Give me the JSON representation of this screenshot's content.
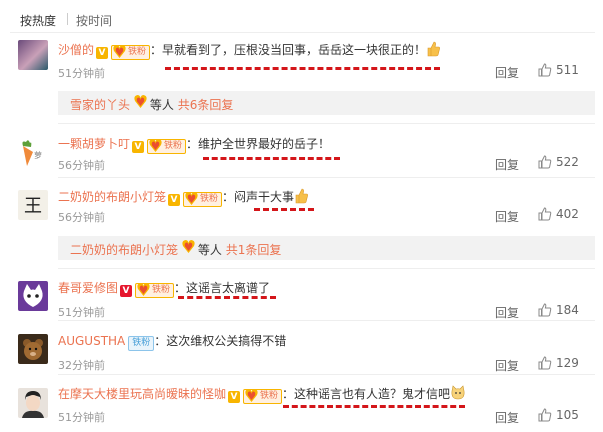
{
  "tabs": {
    "hot": "按热度",
    "time": "按时间"
  },
  "comments": [
    {
      "user": "沙僧的",
      "v": "V",
      "fan": "铁粉",
      "text": "：早就看到了，压根没当回事，岳岳这一块很正的！",
      "time": "51分钟前",
      "reply": "回复",
      "likes": "511"
    },
    {
      "user": "一颗胡萝卜叮",
      "v": "V",
      "fan": "铁粉",
      "text": "：维护全世界最好的岳子！",
      "time": "56分钟前",
      "reply": "回复",
      "likes": "522"
    },
    {
      "user": "二奶奶的布朗小灯笼",
      "v": "V",
      "fan": "铁粉",
      "text": "：闷声干大事",
      "time": "56分钟前",
      "reply": "回复",
      "likes": "402"
    },
    {
      "user": "春哥爱修图",
      "v": "V",
      "fan": "铁粉",
      "text": "：这谣言太离谱了",
      "time": "51分钟前",
      "reply": "回复",
      "likes": "184"
    },
    {
      "user": "AUGUSTHA",
      "v": "",
      "fan": "铁粉",
      "text": "：这次维权公关搞得不错",
      "time": "32分钟前",
      "reply": "回复",
      "likes": "129"
    },
    {
      "user": "在摩天大楼里玩高尚暧昧的怪咖",
      "v": "V",
      "fan": "铁粉",
      "text": "：这种谣言也有人造？鬼才信吧",
      "time": "51分钟前",
      "reply": "回复",
      "likes": "105"
    }
  ],
  "subreplies": [
    {
      "user": "雪家的丫头",
      "mid": "等人",
      "count": "共6条回复"
    },
    {
      "user": "二奶奶的布朗小灯笼",
      "mid": "等人",
      "count": "共1条回复"
    }
  ],
  "colors": {
    "username": "#eb7350",
    "annotation": "#d4161a",
    "badge": "#f8b500"
  }
}
